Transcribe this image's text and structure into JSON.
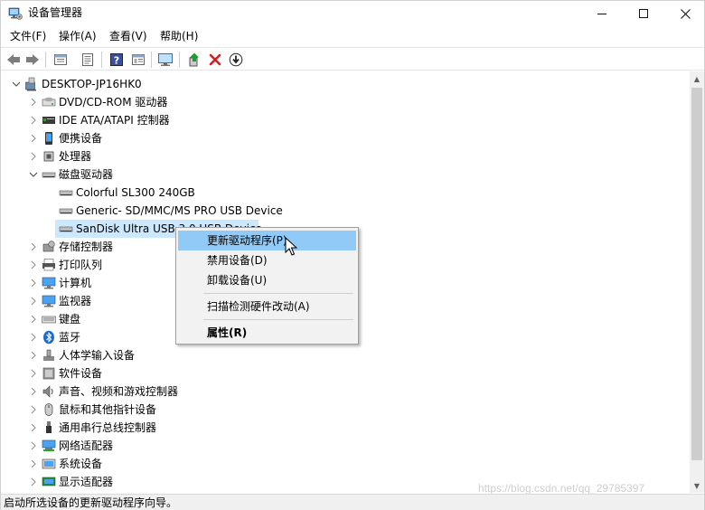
{
  "window": {
    "title": "设备管理器"
  },
  "menubar": {
    "items": [
      "文件(F)",
      "操作(A)",
      "查看(V)",
      "帮助(H)"
    ]
  },
  "toolbar": {
    "buttons": [
      "back-arrow-icon",
      "forward-arrow-icon",
      "properties-icon",
      "list-icon",
      "help-icon",
      "view-icon",
      "monitor-icon",
      "update-driver-icon",
      "uninstall-icon",
      "download-icon"
    ]
  },
  "tree": {
    "root": "DESKTOP-JP16HK0",
    "categories": [
      "DVD/CD-ROM 驱动器",
      "IDE ATA/ATAPI 控制器",
      "便携设备",
      "处理器",
      "磁盘驱动器",
      "存储控制器",
      "打印队列",
      "计算机",
      "监视器",
      "键盘",
      "蓝牙",
      "人体学输入设备",
      "软件设备",
      "声音、视频和游戏控制器",
      "鼠标和其他指针设备",
      "通用串行总线控制器",
      "网络适配器",
      "系统设备",
      "显示适配器"
    ],
    "disk_children": [
      "Colorful SL300 240GB",
      "Generic- SD/MMC/MS PRO USB Device",
      "SanDisk Ultra USB 3.0 USB Device"
    ]
  },
  "context_menu": {
    "items": [
      "更新驱动程序(P)",
      "禁用设备(D)",
      "卸载设备(U)",
      "扫描检测硬件改动(A)",
      "属性(R)"
    ]
  },
  "statusbar": {
    "text": "启动所选设备的更新驱动程序向导。"
  },
  "watermark": "https://blog.csdn.net/qq_29785397",
  "colors": {
    "selection": "#cce8ff",
    "menu_highlight": "#91c9f7",
    "close_red": "#e81123"
  }
}
